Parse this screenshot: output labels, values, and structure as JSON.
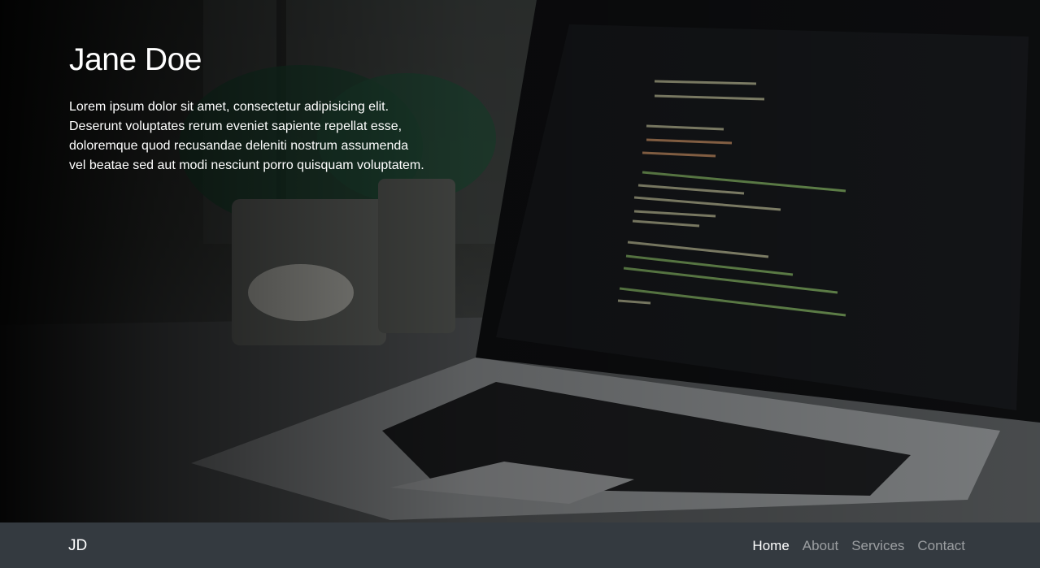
{
  "hero": {
    "title": "Jane Doe",
    "lead": "Lorem ipsum dolor sit amet, consectetur adipisicing elit. Deserunt voluptates rerum eveniet sapiente repellat esse, doloremque quod recusandae deleniti nostrum assumenda vel beatae sed aut modi nesciunt porro quisquam voluptatem."
  },
  "footer": {
    "brand": "JD",
    "nav": [
      {
        "label": "Home",
        "active": true
      },
      {
        "label": "About",
        "active": false
      },
      {
        "label": "Services",
        "active": false
      },
      {
        "label": "Contact",
        "active": false
      }
    ]
  },
  "colors": {
    "footer_bg": "#343a40",
    "nav_active": "#ffffff",
    "nav_inactive": "rgba(255,255,255,0.5)"
  }
}
